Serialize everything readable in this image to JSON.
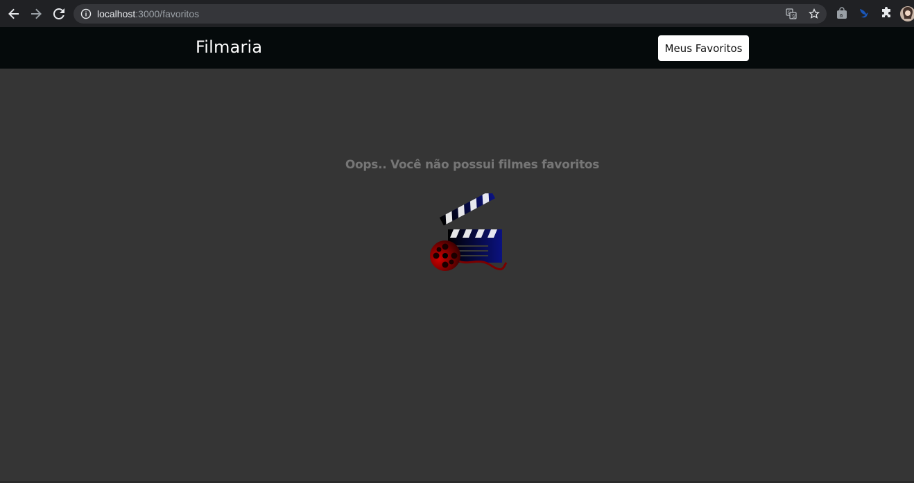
{
  "browser": {
    "url_host": "localhost",
    "url_path": ":3000/favoritos"
  },
  "app": {
    "brand": "Filmaria",
    "favorites_button": "Meus Favoritos"
  },
  "main": {
    "empty_message": "Oops.. Você não possui filmes favoritos"
  },
  "colors": {
    "page_bg": "#353535",
    "header_bg": "#050a0b",
    "message": "#767676"
  },
  "icons": {
    "back": "back-arrow-icon",
    "forward": "forward-arrow-icon",
    "reload": "reload-icon",
    "info": "info-icon",
    "translate": "translate-icon",
    "bookmark": "star-icon",
    "extensions": "puzzle-icon",
    "illustration": "film-clapperboard-icon"
  }
}
